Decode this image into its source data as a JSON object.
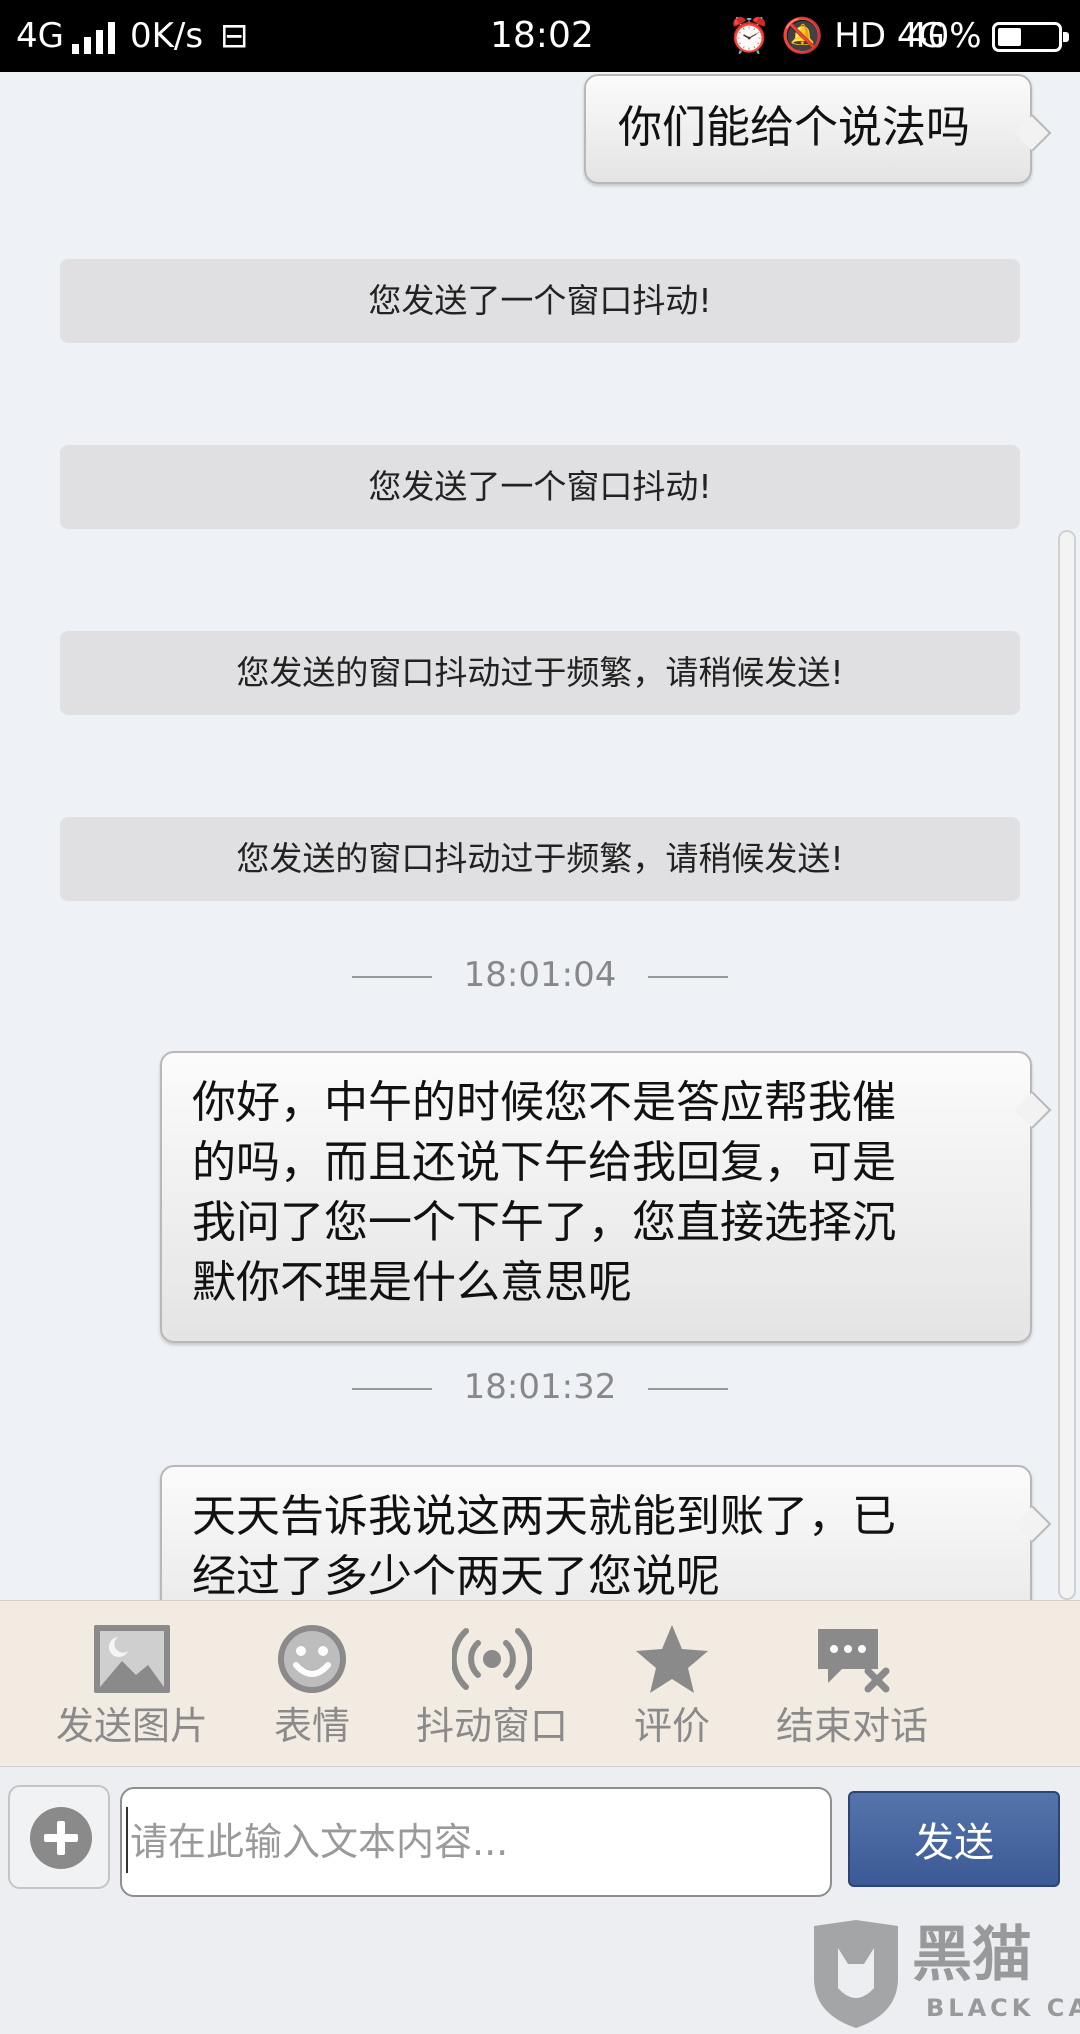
{
  "status_bar": {
    "network": "4G",
    "speed": "0K/s",
    "sim_icon": "sim-card-icon",
    "time": "18:02",
    "icons": "⏰ 🔕 HD 4G",
    "battery_percent": "40%",
    "battery_level": 0.4
  },
  "messages": [
    {
      "type": "bubble",
      "text": "你们能给个说法吗"
    },
    {
      "type": "system",
      "text": "您发送了一个窗口抖动!"
    },
    {
      "type": "system",
      "text": "您发送了一个窗口抖动!"
    },
    {
      "type": "system",
      "text": "您发送的窗口抖动过于频繁，请稍候发送!"
    },
    {
      "type": "system",
      "text": "您发送的窗口抖动过于频繁，请稍候发送!"
    },
    {
      "type": "timestamp",
      "text": "18:01:04"
    },
    {
      "type": "bubble",
      "lines": [
        "你好，中午的时候您不是答应帮我催",
        "的吗，而且还说下午给我回复，可是",
        "我问了您一个下午了，您直接选择沉",
        "默你不理是什么意思呢"
      ]
    },
    {
      "type": "timestamp",
      "text": "18:01:32"
    },
    {
      "type": "bubble",
      "lines": [
        "天天告诉我说这两天就能到账了，已",
        "经过了多少个两天了您说呢"
      ]
    }
  ],
  "toolbar": {
    "items": [
      {
        "label": "发送图片",
        "icon": "image-icon"
      },
      {
        "label": "表情",
        "icon": "emoji-icon"
      },
      {
        "label": "抖动窗口",
        "icon": "shake-icon"
      },
      {
        "label": "评价",
        "icon": "star-icon"
      },
      {
        "label": "结束对话",
        "icon": "end-chat-icon"
      }
    ]
  },
  "input": {
    "placeholder": "请在此输入文本内容...",
    "send_label": "发送"
  },
  "watermark": {
    "brand": "黑猫",
    "brand_en": "BLACK CAT"
  }
}
